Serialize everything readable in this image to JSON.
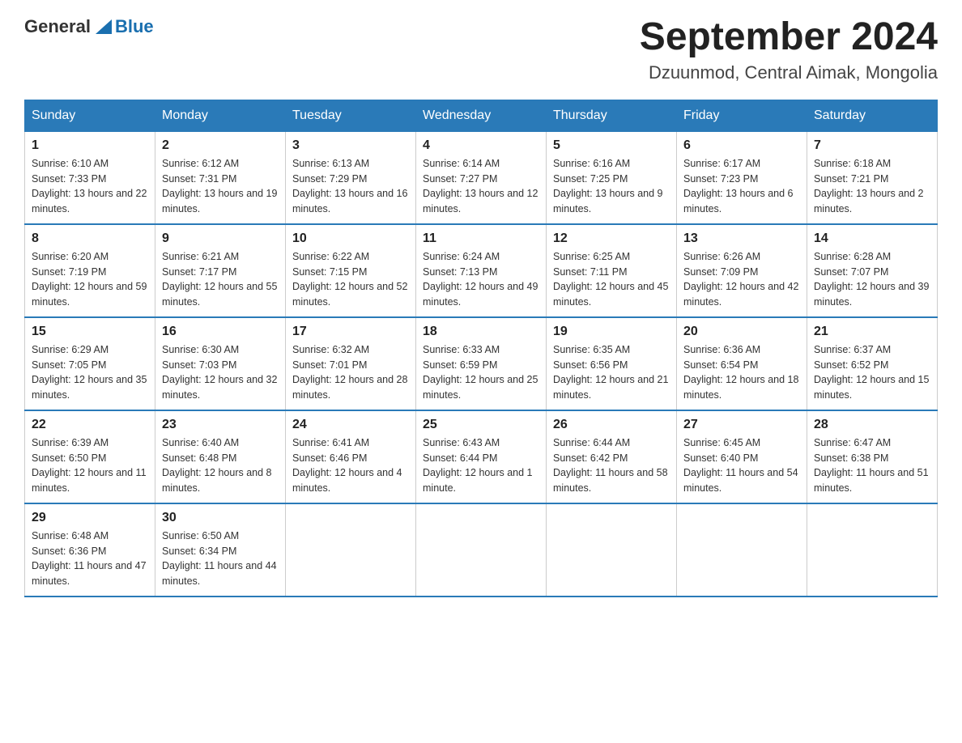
{
  "header": {
    "logo_general": "General",
    "logo_blue": "Blue",
    "title": "September 2024",
    "subtitle": "Dzuunmod, Central Aimak, Mongolia"
  },
  "weekdays": [
    "Sunday",
    "Monday",
    "Tuesday",
    "Wednesday",
    "Thursday",
    "Friday",
    "Saturday"
  ],
  "weeks": [
    [
      {
        "day": "1",
        "sunrise": "6:10 AM",
        "sunset": "7:33 PM",
        "daylight": "13 hours and 22 minutes."
      },
      {
        "day": "2",
        "sunrise": "6:12 AM",
        "sunset": "7:31 PM",
        "daylight": "13 hours and 19 minutes."
      },
      {
        "day": "3",
        "sunrise": "6:13 AM",
        "sunset": "7:29 PM",
        "daylight": "13 hours and 16 minutes."
      },
      {
        "day": "4",
        "sunrise": "6:14 AM",
        "sunset": "7:27 PM",
        "daylight": "13 hours and 12 minutes."
      },
      {
        "day": "5",
        "sunrise": "6:16 AM",
        "sunset": "7:25 PM",
        "daylight": "13 hours and 9 minutes."
      },
      {
        "day": "6",
        "sunrise": "6:17 AM",
        "sunset": "7:23 PM",
        "daylight": "13 hours and 6 minutes."
      },
      {
        "day": "7",
        "sunrise": "6:18 AM",
        "sunset": "7:21 PM",
        "daylight": "13 hours and 2 minutes."
      }
    ],
    [
      {
        "day": "8",
        "sunrise": "6:20 AM",
        "sunset": "7:19 PM",
        "daylight": "12 hours and 59 minutes."
      },
      {
        "day": "9",
        "sunrise": "6:21 AM",
        "sunset": "7:17 PM",
        "daylight": "12 hours and 55 minutes."
      },
      {
        "day": "10",
        "sunrise": "6:22 AM",
        "sunset": "7:15 PM",
        "daylight": "12 hours and 52 minutes."
      },
      {
        "day": "11",
        "sunrise": "6:24 AM",
        "sunset": "7:13 PM",
        "daylight": "12 hours and 49 minutes."
      },
      {
        "day": "12",
        "sunrise": "6:25 AM",
        "sunset": "7:11 PM",
        "daylight": "12 hours and 45 minutes."
      },
      {
        "day": "13",
        "sunrise": "6:26 AM",
        "sunset": "7:09 PM",
        "daylight": "12 hours and 42 minutes."
      },
      {
        "day": "14",
        "sunrise": "6:28 AM",
        "sunset": "7:07 PM",
        "daylight": "12 hours and 39 minutes."
      }
    ],
    [
      {
        "day": "15",
        "sunrise": "6:29 AM",
        "sunset": "7:05 PM",
        "daylight": "12 hours and 35 minutes."
      },
      {
        "day": "16",
        "sunrise": "6:30 AM",
        "sunset": "7:03 PM",
        "daylight": "12 hours and 32 minutes."
      },
      {
        "day": "17",
        "sunrise": "6:32 AM",
        "sunset": "7:01 PM",
        "daylight": "12 hours and 28 minutes."
      },
      {
        "day": "18",
        "sunrise": "6:33 AM",
        "sunset": "6:59 PM",
        "daylight": "12 hours and 25 minutes."
      },
      {
        "day": "19",
        "sunrise": "6:35 AM",
        "sunset": "6:56 PM",
        "daylight": "12 hours and 21 minutes."
      },
      {
        "day": "20",
        "sunrise": "6:36 AM",
        "sunset": "6:54 PM",
        "daylight": "12 hours and 18 minutes."
      },
      {
        "day": "21",
        "sunrise": "6:37 AM",
        "sunset": "6:52 PM",
        "daylight": "12 hours and 15 minutes."
      }
    ],
    [
      {
        "day": "22",
        "sunrise": "6:39 AM",
        "sunset": "6:50 PM",
        "daylight": "12 hours and 11 minutes."
      },
      {
        "day": "23",
        "sunrise": "6:40 AM",
        "sunset": "6:48 PM",
        "daylight": "12 hours and 8 minutes."
      },
      {
        "day": "24",
        "sunrise": "6:41 AM",
        "sunset": "6:46 PM",
        "daylight": "12 hours and 4 minutes."
      },
      {
        "day": "25",
        "sunrise": "6:43 AM",
        "sunset": "6:44 PM",
        "daylight": "12 hours and 1 minute."
      },
      {
        "day": "26",
        "sunrise": "6:44 AM",
        "sunset": "6:42 PM",
        "daylight": "11 hours and 58 minutes."
      },
      {
        "day": "27",
        "sunrise": "6:45 AM",
        "sunset": "6:40 PM",
        "daylight": "11 hours and 54 minutes."
      },
      {
        "day": "28",
        "sunrise": "6:47 AM",
        "sunset": "6:38 PM",
        "daylight": "11 hours and 51 minutes."
      }
    ],
    [
      {
        "day": "29",
        "sunrise": "6:48 AM",
        "sunset": "6:36 PM",
        "daylight": "11 hours and 47 minutes."
      },
      {
        "day": "30",
        "sunrise": "6:50 AM",
        "sunset": "6:34 PM",
        "daylight": "11 hours and 44 minutes."
      },
      null,
      null,
      null,
      null,
      null
    ]
  ]
}
